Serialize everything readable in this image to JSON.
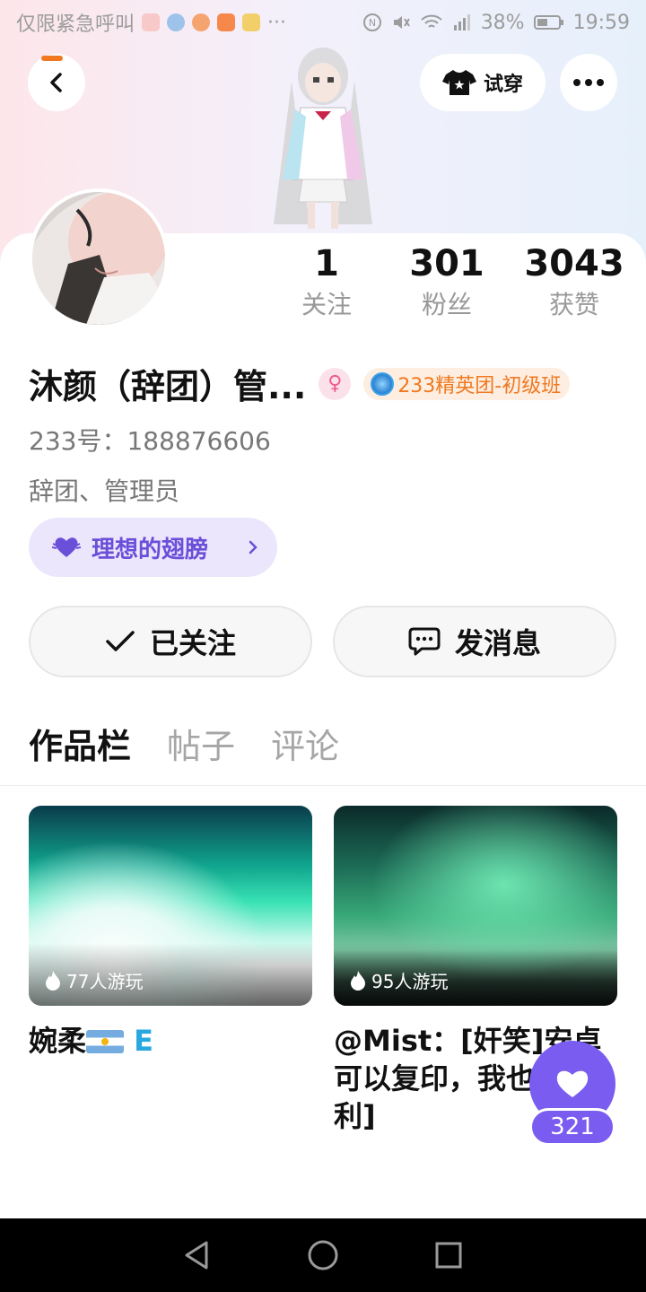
{
  "status_bar": {
    "carrier_text": "仅限紧急呼叫",
    "battery": "38%",
    "time": "19:59",
    "more_dots": "···"
  },
  "header": {
    "try_on_label": "试穿"
  },
  "profile": {
    "stats": [
      {
        "value": "1",
        "label": "关注"
      },
      {
        "value": "301",
        "label": "粉丝"
      },
      {
        "value": "3043",
        "label": "获赞"
      }
    ],
    "name": "沐颜（辞团）管...",
    "gender_symbol": "♀",
    "guild_badge": "233精英团-初级班",
    "uid": "233号：188876606",
    "bio": "辞团、管理员",
    "wing_label": "理想的翅膀"
  },
  "actions": {
    "follow_label": "已关注",
    "message_label": "发消息"
  },
  "tabs": [
    "作品栏",
    "帖子",
    "评论"
  ],
  "works": [
    {
      "plays": "77人游玩",
      "title_text": "婉柔",
      "title_suffix": "E"
    },
    {
      "plays": "95人游玩",
      "title_text": "@Mist：[奸笑]安卓可以复印，我也[胜利]"
    }
  ],
  "like_fab": {
    "count": "321"
  },
  "colors": {
    "accent_purple": "#7a5cf0",
    "accent_orange": "#f07920",
    "wing_pill_bg": "#ebe6fb"
  }
}
